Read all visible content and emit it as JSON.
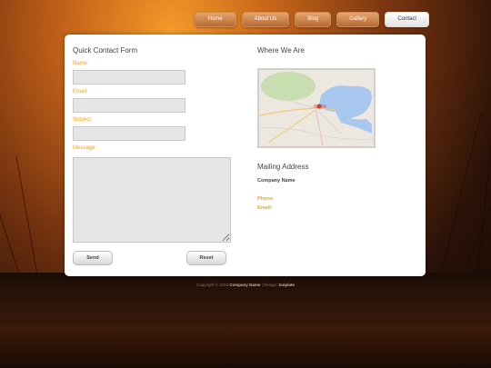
{
  "nav": {
    "items": [
      {
        "label": "Home"
      },
      {
        "label": "About Us"
      },
      {
        "label": "Blog"
      },
      {
        "label": "Gallery"
      },
      {
        "label": "Contact"
      }
    ],
    "active": "Contact"
  },
  "contact_form": {
    "title": "Quick Contact Form",
    "name_label": "Name:",
    "email_label": "Email:",
    "subject_label": "Subject:",
    "message_label": "Message:",
    "send_label": "Send",
    "reset_label": "Reset"
  },
  "location": {
    "title": "Where We Are"
  },
  "mailing": {
    "title": "Mailing Address",
    "company": "Company Name",
    "phone_label": "Phone:",
    "email_label": "Email:"
  },
  "footer": {
    "copyright": "Copyright © 2048",
    "company": "Company Name",
    "separator": "| Design:",
    "designer": "tooplate"
  },
  "colors": {
    "accent": "#f0a31a",
    "panel": "#ffffff"
  }
}
